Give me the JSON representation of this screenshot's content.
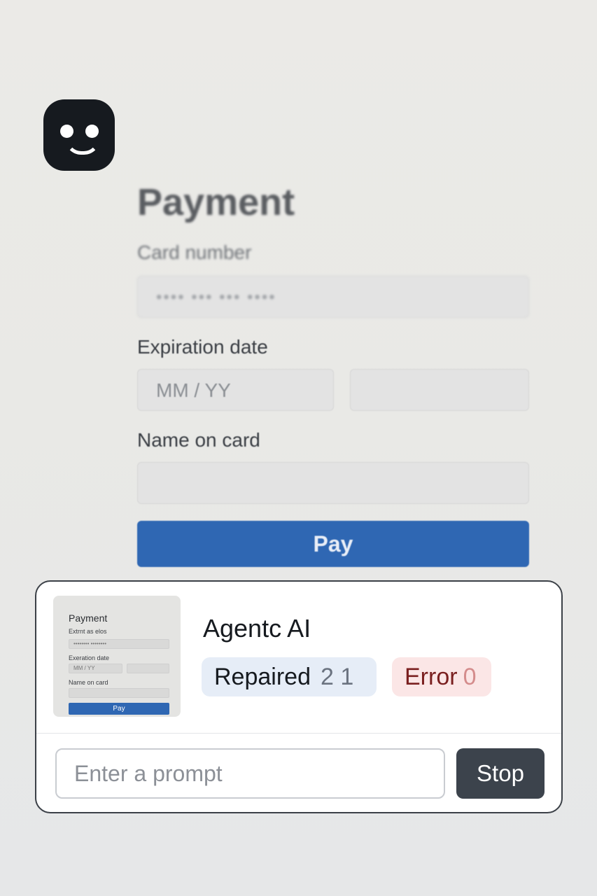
{
  "app": {
    "logo_icon": "smiley-face-icon"
  },
  "background_form": {
    "title": "Payment",
    "card_label": "Card number",
    "card_placeholder": "•••• ••• ••• ••••",
    "expiration_label": "Expiration date",
    "expiration_placeholder": "MM / YY",
    "name_label": "Name on card",
    "pay_label": "Pay"
  },
  "thumbnail": {
    "title": "Payment",
    "card_label": "Extrnt as elos",
    "card_placeholder": "•••••••• ••••••••",
    "expiration_label": "Exeration date",
    "expiration_placeholder": "MM / YY",
    "name_label": "Name on card",
    "pay_label": "Pay"
  },
  "agent": {
    "title": "Agentc AI",
    "repaired_label": "Repaired",
    "repaired_counts": "2 1",
    "error_label": "Error",
    "error_count": "0",
    "prompt_placeholder": "Enter a prompt",
    "stop_label": "Stop"
  },
  "colors": {
    "accent": "#2f67b3",
    "dark": "#161a1f",
    "stop_button": "#3c434c",
    "error_bg": "#fbe6e6",
    "repaired_bg": "#e6edf7"
  }
}
